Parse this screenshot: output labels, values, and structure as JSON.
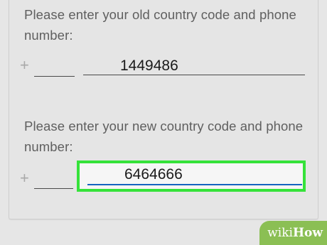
{
  "old_section": {
    "prompt": "Please enter your old country code and phone number:",
    "plus": "+",
    "country_code_value": "",
    "phone_value": "1449486"
  },
  "new_section": {
    "prompt": "Please enter your new country code and phone number:",
    "plus": "+",
    "country_code_value": "",
    "phone_value": "6464666"
  },
  "watermark": {
    "wiki": "wiki",
    "how": "How"
  },
  "colors": {
    "highlight": "#35e23a",
    "active_underline": "#1565c0",
    "watermark_bg": "#8bbf54"
  }
}
